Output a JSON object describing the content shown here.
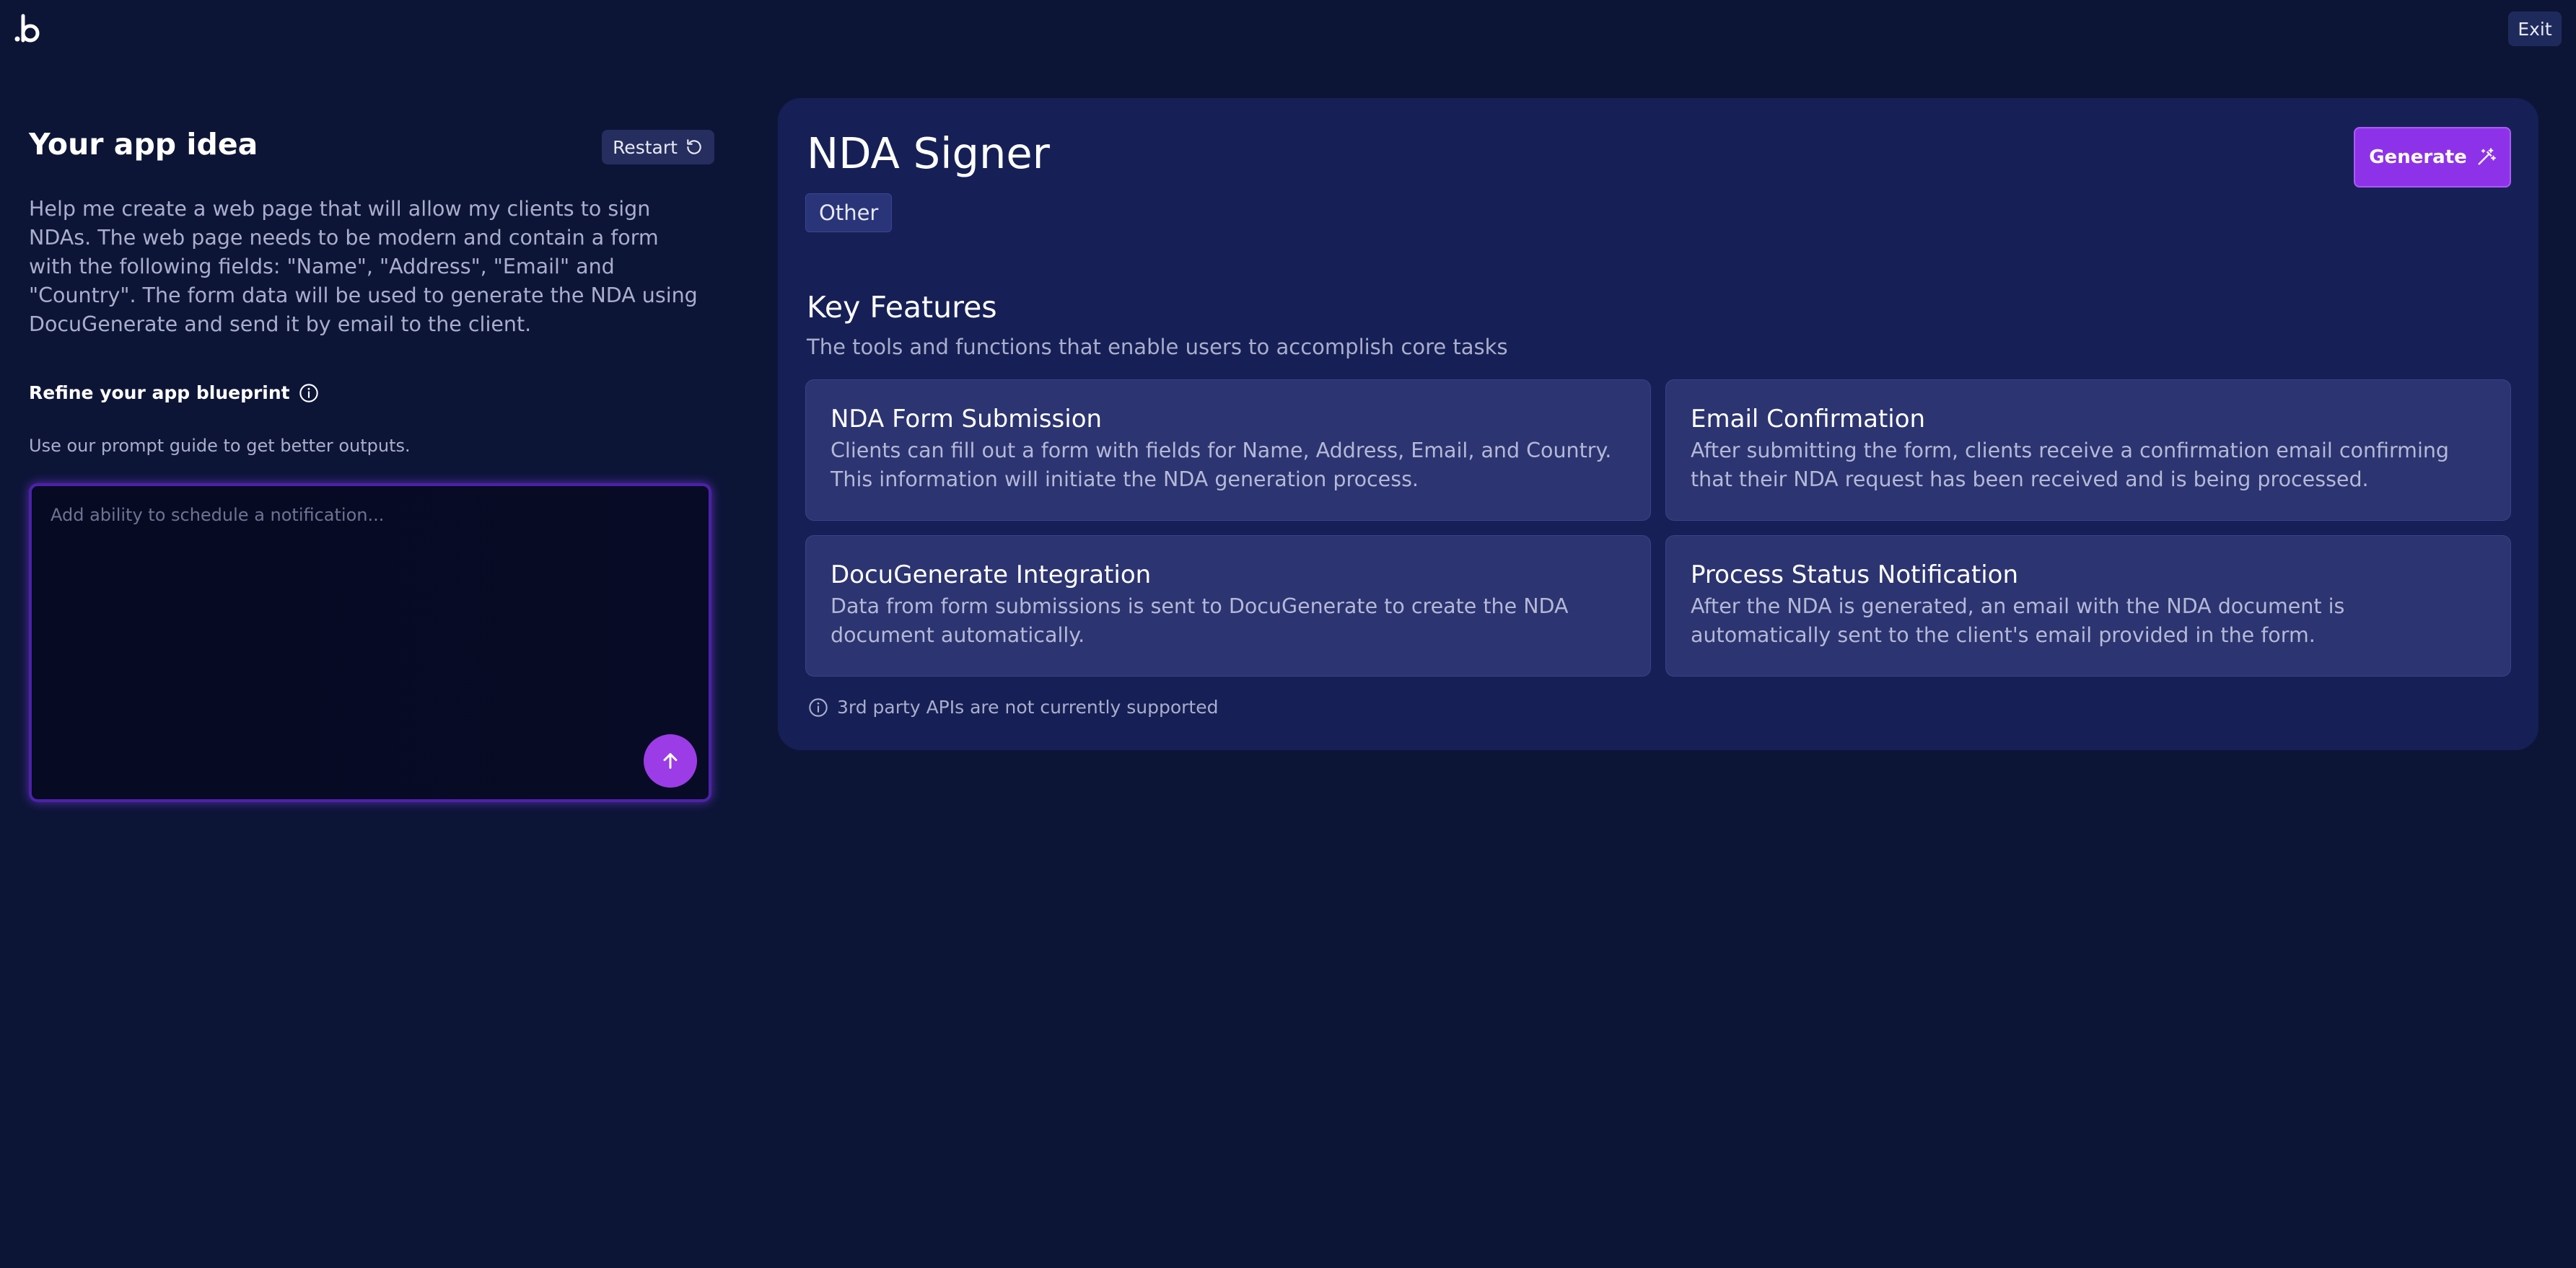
{
  "header": {
    "logo_alt": ".b",
    "exit_label": "Exit"
  },
  "idea": {
    "title": "Your app idea",
    "restart_label": "Restart",
    "description": "Help me create a web page that will allow my clients to sign NDAs. The web page needs to be modern and contain a form with the following fields: \"Name\", \"Address\", \"Email\" and \"Country\". The form data will be used to generate the NDA using DocuGenerate and send it by email to the client.",
    "refine_title": "Refine your app blueprint",
    "refine_hint": "Use our prompt guide to get better outputs.",
    "prompt_placeholder": "Add ability to schedule a notification...",
    "prompt_value": ""
  },
  "blueprint": {
    "app_name": "NDA Signer",
    "category": "Other",
    "generate_label": "Generate",
    "features_title": "Key Features",
    "features_subtitle": "The tools and functions that enable users to accomplish core tasks",
    "features": [
      {
        "title": "NDA Form Submission",
        "description": "Clients can fill out a form with fields for Name, Address, Email, and Country. This information will initiate the NDA generation process."
      },
      {
        "title": "Email Confirmation",
        "description": "After submitting the form, clients receive a confirmation email confirming that their NDA request has been received and is being processed."
      },
      {
        "title": "DocuGenerate Integration",
        "description": "Data from form submissions is sent to DocuGenerate to create the NDA document automatically."
      },
      {
        "title": "Process Status Notification",
        "description": "After the NDA is generated, an email with the NDA document is automatically sent to the client's email provided in the form."
      }
    ],
    "note": "3rd party APIs are not currently supported"
  },
  "colors": {
    "background": "#0d1537",
    "panel": "#162056",
    "card": "#2c3471",
    "accent": "#9b3ce6",
    "muted_text": "#a9aecb"
  },
  "icons": {
    "logo": "brand-logo-icon",
    "restart": "restart-icon",
    "info": "info-icon",
    "send": "arrow-up-icon",
    "generate": "magic-wand-icon",
    "note": "info-icon"
  }
}
